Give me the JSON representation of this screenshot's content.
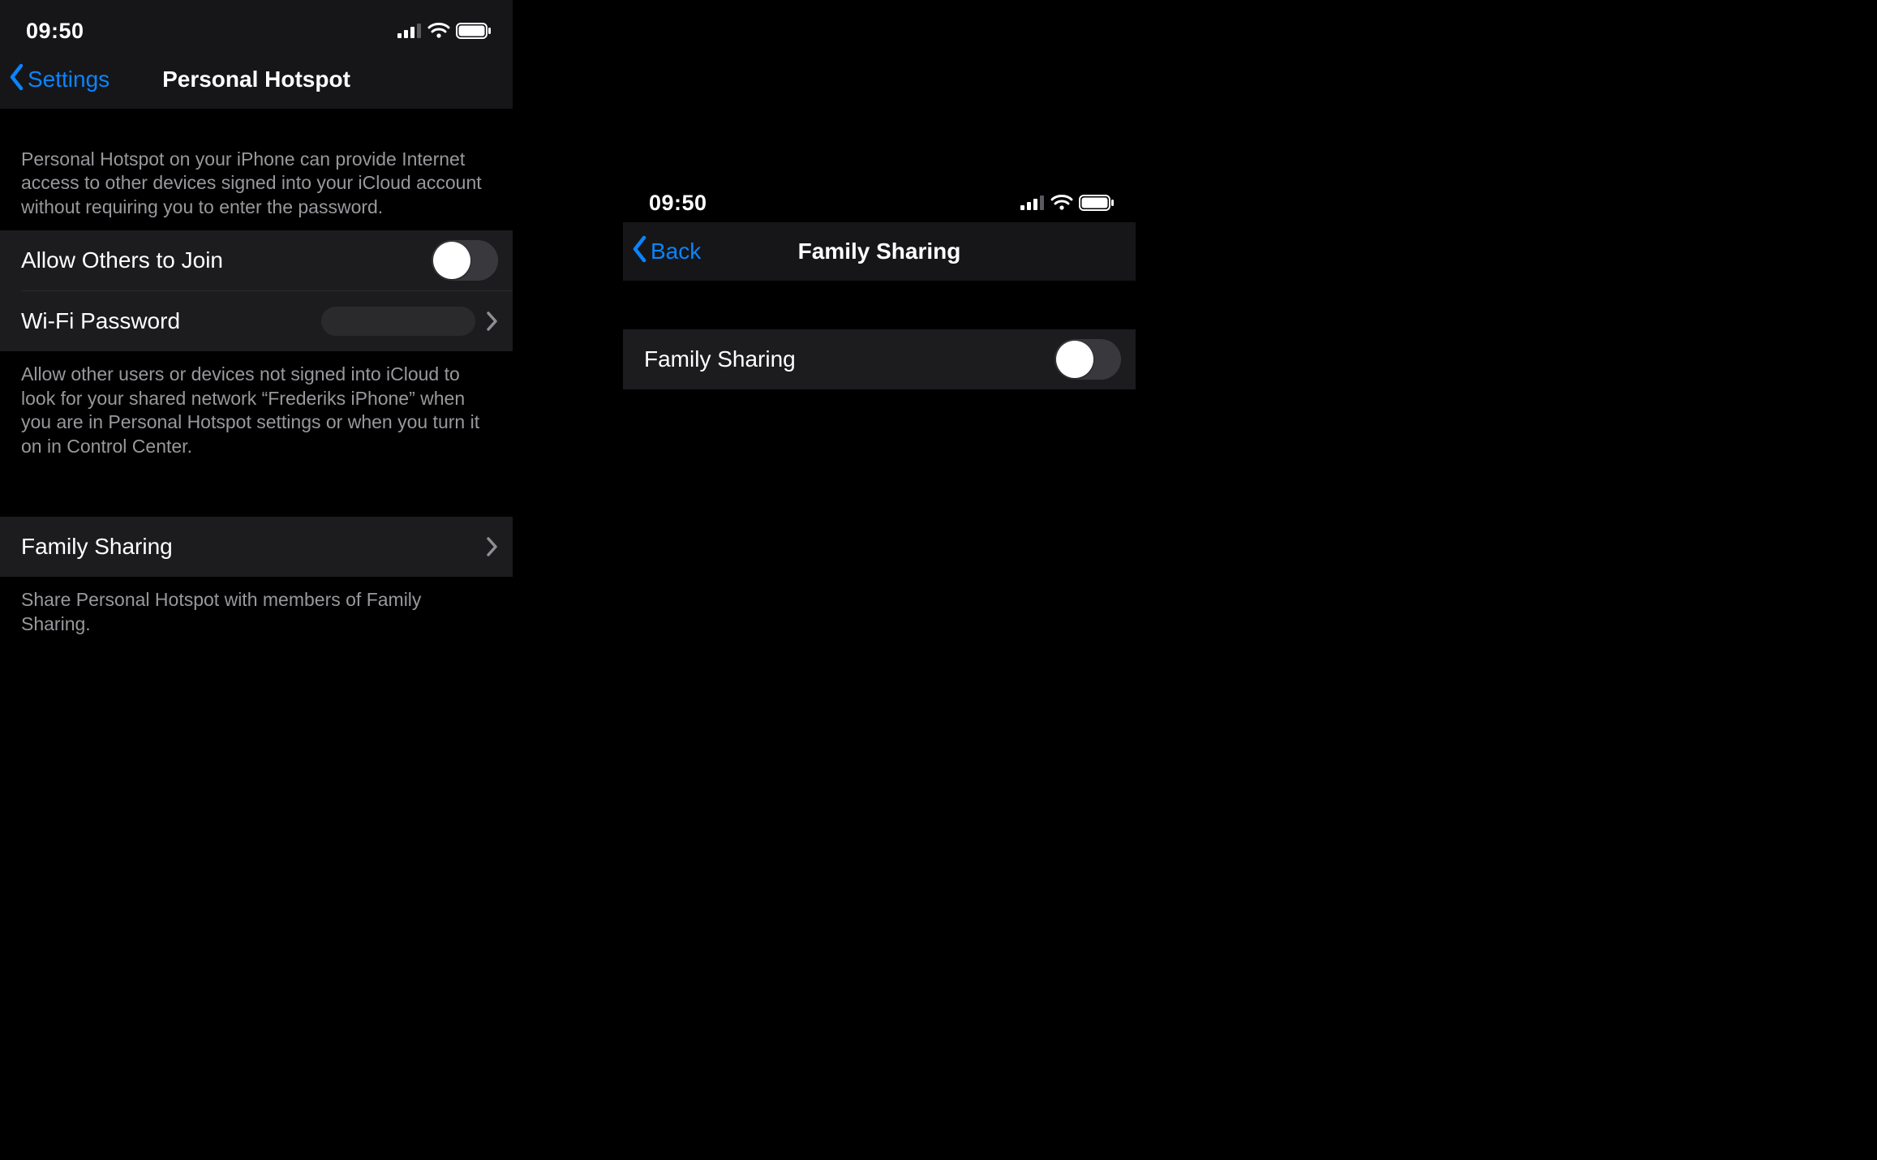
{
  "status": {
    "time": "09:50"
  },
  "left": {
    "back_label": "Settings",
    "title": "Personal Hotspot",
    "intro": "Personal Hotspot on your iPhone can provide Internet access to other devices signed into your iCloud account without requiring you to enter the password.",
    "cells": {
      "allow_label": "Allow Others to Join",
      "wifi_label": "Wi-Fi Password",
      "family_label": "Family Sharing"
    },
    "allow_footer": "Allow other users or devices not signed into iCloud to look for your shared network “Frederiks iPhone” when you are in Personal Hotspot settings or when you turn it on in Control Center.",
    "family_footer": "Share Personal Hotspot with members of Family Sharing."
  },
  "right": {
    "back_label": "Back",
    "title": "Family Sharing",
    "cells": {
      "family_toggle_label": "Family Sharing"
    }
  }
}
